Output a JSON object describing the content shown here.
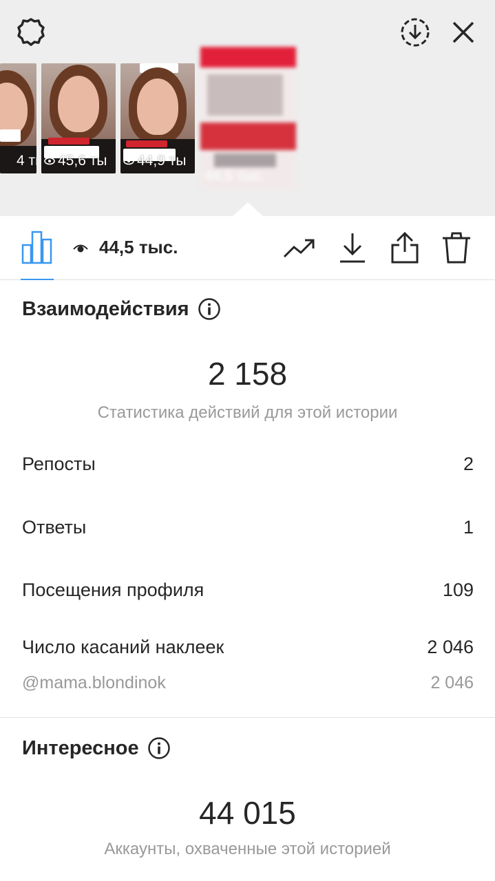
{
  "thumbnails": [
    {
      "views": "4 ты"
    },
    {
      "views": "45,6 ты"
    },
    {
      "views": "44,9 ты"
    }
  ],
  "selected_thumbnail": {
    "views": "44,5 тыс."
  },
  "toolbar": {
    "view_count": "44,5 тыс.",
    "accent_color": "#3897f0"
  },
  "interactions": {
    "title": "Взаимодействия",
    "total": "2 158",
    "caption": "Статистика действий для этой истории",
    "rows": [
      {
        "label": "Репосты",
        "value": "2"
      },
      {
        "label": "Ответы",
        "value": "1"
      },
      {
        "label": "Посещения профиля",
        "value": "109"
      },
      {
        "label": "Число касаний наклеек",
        "value": "2 046"
      }
    ],
    "sticker": {
      "label": "@mama.blondinok",
      "value": "2 046"
    }
  },
  "discovery": {
    "title": "Интересное",
    "total": "44 015",
    "caption": "Аккаунты, охваченные этой историей"
  },
  "icons": [
    "settings-icon",
    "save-story-icon",
    "close-icon",
    "bar-chart-icon",
    "eye-icon",
    "trending-icon",
    "download-icon",
    "share-icon",
    "trash-icon",
    "info-icon"
  ]
}
